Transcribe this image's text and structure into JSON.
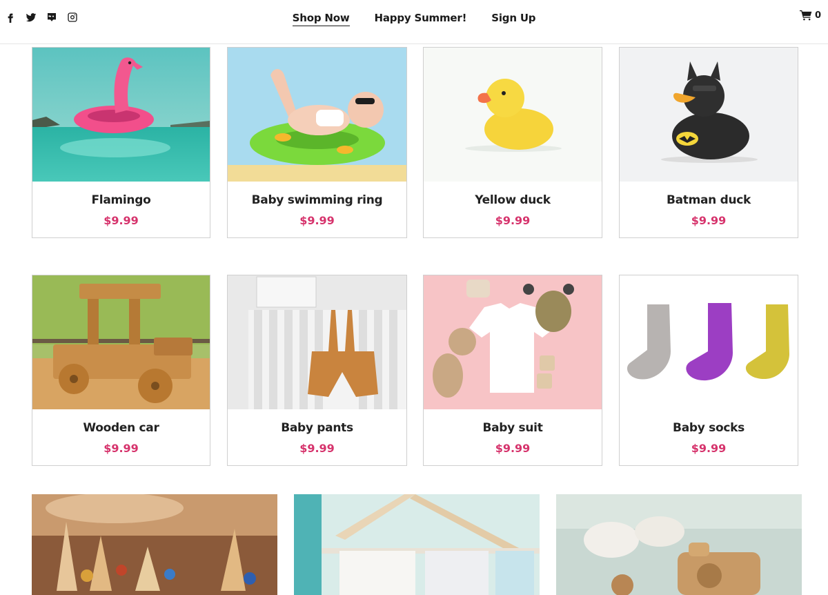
{
  "header": {
    "social": [
      {
        "icon": "facebook-icon"
      },
      {
        "icon": "twitter-icon"
      },
      {
        "icon": "discord-icon"
      },
      {
        "icon": "instagram-icon"
      }
    ],
    "nav": [
      {
        "label": "Shop Now",
        "active": true
      },
      {
        "label": "Happy Summer!",
        "active": false
      },
      {
        "label": "Sign Up",
        "active": false
      }
    ],
    "cart": {
      "icon": "cart-icon",
      "count": "0"
    }
  },
  "products": [
    {
      "name": "Flamingo",
      "price": "$9.99",
      "image": "flamingo-float-photo"
    },
    {
      "name": "Baby swimming ring",
      "price": "$9.99",
      "image": "baby-swimming-ring-photo"
    },
    {
      "name": "Yellow duck",
      "price": "$9.99",
      "image": "yellow-duck-photo"
    },
    {
      "name": "Batman duck",
      "price": "$9.99",
      "image": "batman-duck-photo"
    },
    {
      "name": "Wooden car",
      "price": "$9.99",
      "image": "wooden-car-photo"
    },
    {
      "name": "Baby pants",
      "price": "$9.99",
      "image": "baby-pants-photo"
    },
    {
      "name": "Baby suit",
      "price": "$9.99",
      "image": "baby-suit-photo"
    },
    {
      "name": "Baby socks",
      "price": "$9.99",
      "image": "baby-socks-photo"
    }
  ],
  "banners": [
    {
      "image": "wooden-toys-photo"
    },
    {
      "image": "baby-clothes-rack-photo"
    },
    {
      "image": "baby-shoes-toys-photo"
    }
  ],
  "colors": {
    "price": "#d6336c",
    "text": "#222222",
    "border": "#cfcfcf"
  }
}
